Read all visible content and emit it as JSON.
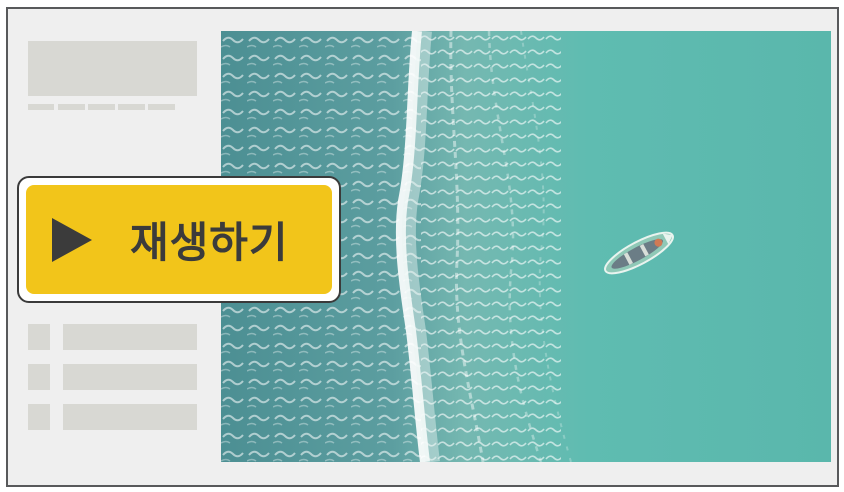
{
  "player": {
    "play_label": "재생하기",
    "play_icon": "play-icon",
    "accent_color": "#f2c51a"
  }
}
